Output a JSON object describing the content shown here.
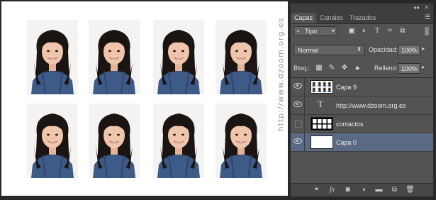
{
  "watermark": "http://www.dzoom.org.es",
  "panel": {
    "tabs": [
      {
        "label": "Capas",
        "active": true
      },
      {
        "label": "Canales",
        "active": false
      },
      {
        "label": "Trazados",
        "active": false
      }
    ],
    "filter": {
      "label": "Tipo"
    },
    "blend_mode": "Normal",
    "opacity_label": "Opacidad:",
    "opacity_value": "100%",
    "lock_label": "Bloq.:",
    "fill_label": "Relleno:",
    "fill_value": "100%",
    "layers": [
      {
        "name": "Capa 9",
        "visible": true,
        "kind": "photos",
        "selected": false
      },
      {
        "name": "http://www.dzoom.org.es",
        "visible": true,
        "kind": "text",
        "selected": false
      },
      {
        "name": "contactos",
        "visible": false,
        "kind": "grid",
        "selected": false
      },
      {
        "name": "Capa 0",
        "visible": true,
        "kind": "white",
        "selected": true
      }
    ]
  },
  "colors": {
    "selected_layer": "#5b6a84",
    "panel_bg": "#535353",
    "document_bg": "#ffffff"
  }
}
